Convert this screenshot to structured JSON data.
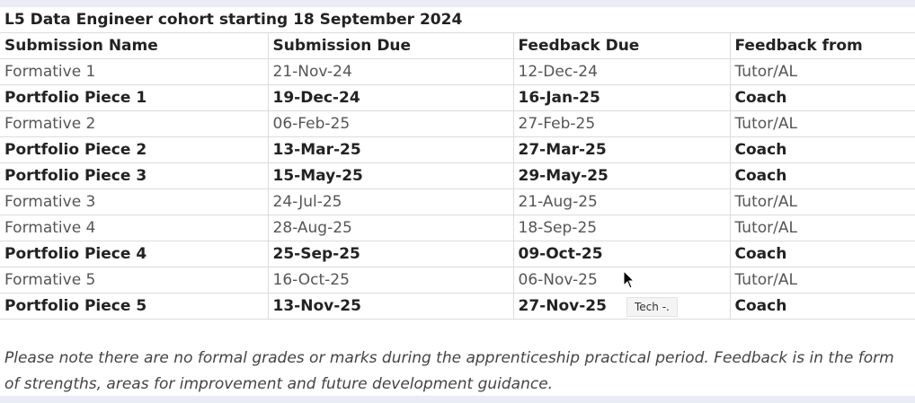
{
  "cohort_title": "L5 Data Engineer cohort starting 18 September 2024",
  "columns": {
    "name": "Submission Name",
    "submission_due": "Submission Due",
    "feedback_due": "Feedback Due",
    "feedback_from": "Feedback from"
  },
  "rows": [
    {
      "name": "Formative 1",
      "submission_due": "21-Nov-24",
      "feedback_due": "12-Dec-24",
      "feedback_from": "Tutor/AL",
      "bold": false
    },
    {
      "name": "Portfolio Piece 1",
      "submission_due": "19-Dec-24",
      "feedback_due": "16-Jan-25",
      "feedback_from": "Coach",
      "bold": true
    },
    {
      "name": "Formative 2",
      "submission_due": "06-Feb-25",
      "feedback_due": "27-Feb-25",
      "feedback_from": "Tutor/AL",
      "bold": false
    },
    {
      "name": "Portfolio Piece 2",
      "submission_due": "13-Mar-25",
      "feedback_due": "27-Mar-25",
      "feedback_from": "Coach",
      "bold": true
    },
    {
      "name": "Portfolio Piece 3",
      "submission_due": "15-May-25",
      "feedback_due": "29-May-25",
      "feedback_from": "Coach",
      "bold": true
    },
    {
      "name": "Formative 3",
      "submission_due": "24-Jul-25",
      "feedback_due": "21-Aug-25",
      "feedback_from": "Tutor/AL",
      "bold": false
    },
    {
      "name": "Formative 4",
      "submission_due": "28-Aug-25",
      "feedback_due": "18-Sep-25",
      "feedback_from": "Tutor/AL",
      "bold": false
    },
    {
      "name": "Portfolio Piece 4",
      "submission_due": "25-Sep-25",
      "feedback_due": "09-Oct-25",
      "feedback_from": "Coach",
      "bold": true
    },
    {
      "name": "Formative 5",
      "submission_due": "16-Oct-25",
      "feedback_due": "06-Nov-25",
      "feedback_from": "Tutor/AL",
      "bold": false
    },
    {
      "name": "Portfolio Piece 5",
      "submission_due": "13-Nov-25",
      "feedback_due": "27-Nov-25",
      "feedback_from": "Coach",
      "bold": true
    }
  ],
  "note": "Please note there are no formal grades or marks during the apprenticeship practical period. Feedback is in the form of strengths, areas for improvement and future development guidance.",
  "tooltip": "Tech -.",
  "cursor_icon": "mouse-pointer-icon"
}
